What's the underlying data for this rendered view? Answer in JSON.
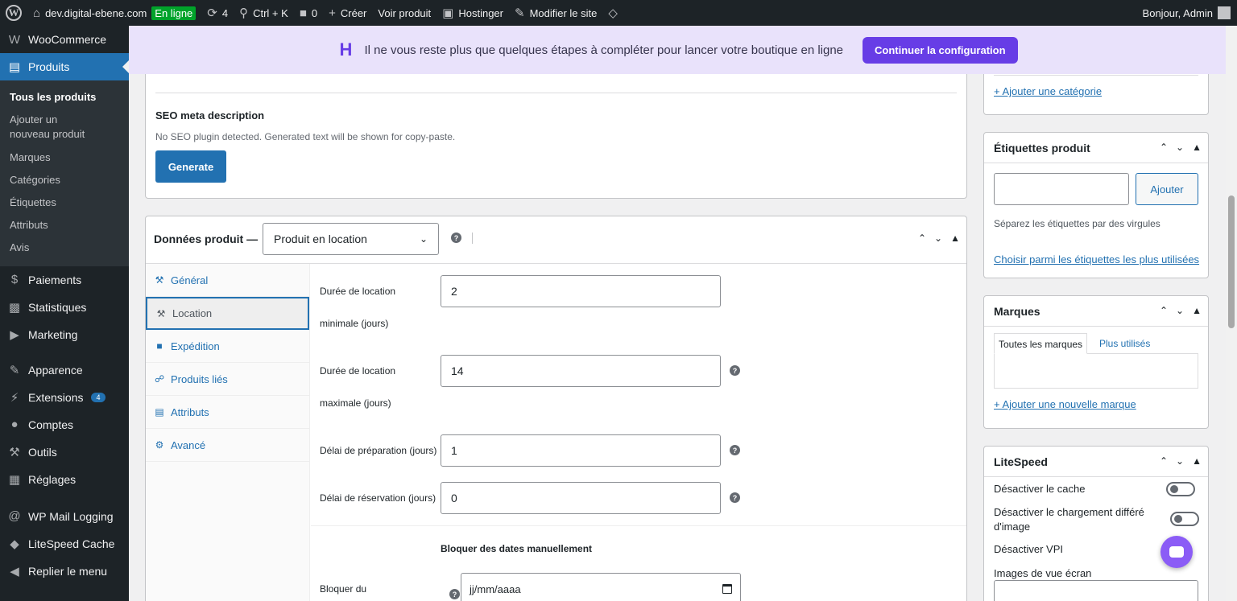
{
  "adminbar": {
    "site": "dev.digital-ebene.com",
    "status": "En ligne",
    "updates": "4",
    "search": "Ctrl + K",
    "comments": "0",
    "create": "Créer",
    "view_product": "Voir produit",
    "hostinger": "Hostinger",
    "edit_site": "Modifier le site",
    "greeting": "Bonjour, Admin"
  },
  "sidebar": {
    "woocommerce": "WooCommerce",
    "products": "Produits",
    "sub": [
      "Tous les produits",
      "Ajouter un nouveau produit",
      "Marques",
      "Catégories",
      "Étiquettes",
      "Attributs",
      "Avis"
    ],
    "payments": "Paiements",
    "stats": "Statistiques",
    "marketing": "Marketing",
    "appearance": "Apparence",
    "extensions": "Extensions",
    "extensions_count": "4",
    "accounts": "Comptes",
    "tools": "Outils",
    "settings": "Réglages",
    "mail_logging": "WP Mail Logging",
    "litespeed": "LiteSpeed Cache",
    "collapse": "Replier le menu"
  },
  "notice": {
    "text": "Il ne vous reste plus que quelques étapes à compléter pour lancer votre boutique en ligne",
    "button": "Continuer la configuration"
  },
  "seo": {
    "title": "SEO meta description",
    "note": "No SEO plugin detected. Generated text will be shown for copy-paste.",
    "button": "Generate"
  },
  "product_data": {
    "label": "Données produit —",
    "type": "Produit en location",
    "tabs": [
      "Général",
      "Location",
      "Expédition",
      "Produits liés",
      "Attributs",
      "Avancé"
    ],
    "fields": {
      "min_label_1": "Durée de location",
      "min_label_2": "minimale (jours)",
      "min_value": "2",
      "max_label_1": "Durée de location",
      "max_label_2": "maximale (jours)",
      "max_value": "14",
      "prep_label": "Délai de préparation (jours)",
      "prep_value": "1",
      "resa_label": "Délai de réservation (jours)",
      "resa_value": "0",
      "block_title": "Bloquer des dates manuellement",
      "block_from": "Bloquer du",
      "date_placeholder": "jj/mm/aaaa"
    }
  },
  "right": {
    "add_category": "+ Ajouter une catégorie",
    "tags_title": "Étiquettes produit",
    "tags_add": "Ajouter",
    "tags_hint": "Séparez les étiquettes par des virgules",
    "tags_choose": "Choisir parmi les étiquettes les plus utilisées",
    "brands_title": "Marques",
    "brands_tab_all": "Toutes les marques",
    "brands_tab_used": "Plus utilisés",
    "brands_add": "+ Ajouter une nouvelle marque",
    "ls_title": "LiteSpeed",
    "ls_cache": "Désactiver le cache",
    "ls_lazy": "Désactiver le chargement différé d'image",
    "ls_vpi": "Désactiver VPI",
    "ls_viewport": "Images de vue écran"
  }
}
